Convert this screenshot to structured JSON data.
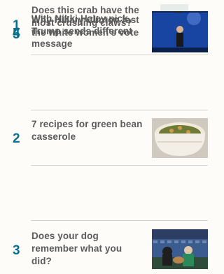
{
  "stories": [
    {
      "rank": "1",
      "headline": "Does this crab have the most crushing claws?",
      "image": "crab-photo"
    },
    {
      "rank": "2",
      "headline": "7 recipes for green bean casserole",
      "image": "casserole-photo"
    },
    {
      "rank": "3",
      "headline": "Does your dog remember what you did?",
      "image": "dog-stadium-photo"
    },
    {
      "rank": "4",
      "headline": "With Nikki Haley pick, Trump sends different message",
      "image": "nikki-haley-photo"
    },
    {
      "rank": "5",
      "headline": "Why Hillary Clinton lost the white women's vote",
      "image": "hillary-clinton-stage-photo"
    }
  ],
  "colors": {
    "rank": "#0a6f8c",
    "headline": "#5b5b5b",
    "divider": "#d7d5cf",
    "background": "#fdfcf9"
  }
}
